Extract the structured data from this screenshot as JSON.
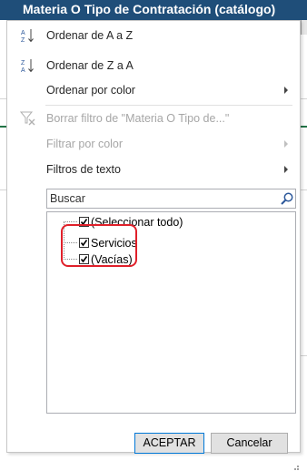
{
  "header": {
    "title": "Materia O Tipo de Contratación (catálogo)"
  },
  "menu": {
    "sort_az": "Ordenar de A a Z",
    "sort_za": "Ordenar de Z a A",
    "sort_by_color": "Ordenar por color",
    "clear_filter": "Borrar filtro de \"Materia O Tipo de...\"",
    "filter_by_color": "Filtrar por color",
    "text_filters": "Filtros de texto"
  },
  "search": {
    "placeholder": "Buscar"
  },
  "list": {
    "items": [
      {
        "label": "(Seleccionar todo)",
        "checked": true
      },
      {
        "label": "Servicios",
        "checked": true
      },
      {
        "label": "(Vacías)",
        "checked": true
      }
    ]
  },
  "buttons": {
    "ok": "ACEPTAR",
    "cancel": "Cancelar"
  },
  "colors": {
    "header_bg": "#1f4e79",
    "highlight": "#e0202a",
    "accent": "#217346"
  }
}
